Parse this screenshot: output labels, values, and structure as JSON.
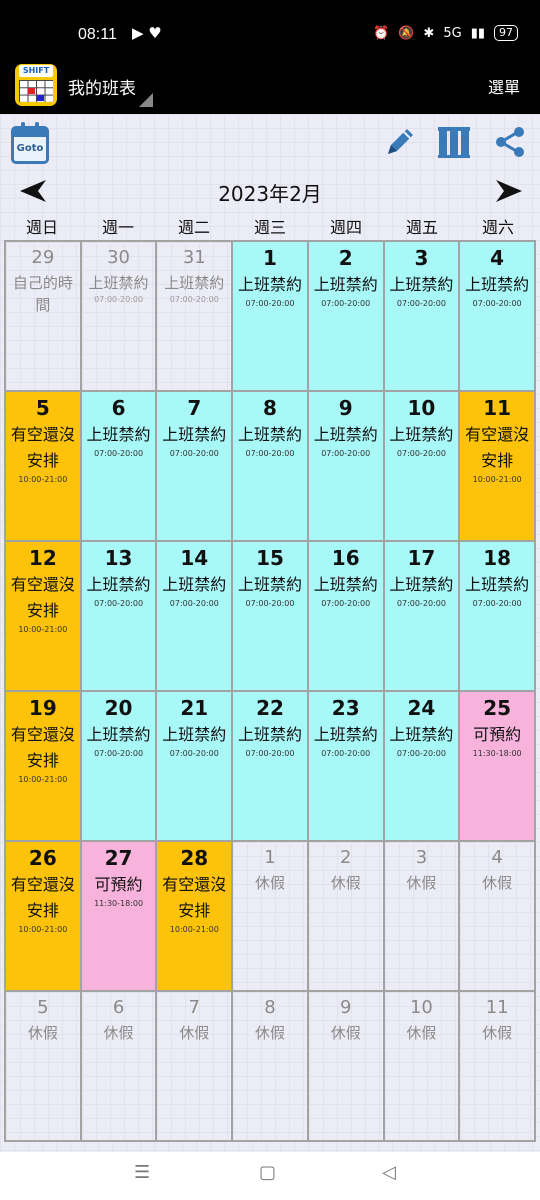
{
  "status_bar": {
    "time": "08:11",
    "left_icons": "▶ ♥",
    "network": "5G",
    "battery": "97"
  },
  "app_bar": {
    "title": "我的班表",
    "app_icon_label": "SHIFT",
    "menu_label": "選單"
  },
  "toolbar": {
    "goto_label": "Goto"
  },
  "calendar": {
    "month_title": "2023年2月",
    "weekdays": [
      "週日",
      "週一",
      "週二",
      "週三",
      "週四",
      "週五",
      "週六"
    ],
    "colors": {
      "work": "#a9f8f8",
      "free": "#fcc30a",
      "book": "#f8b3dc",
      "off": "#ececf6"
    },
    "cells": [
      {
        "day": "29",
        "label": "自己的時間",
        "time": "",
        "type": "other"
      },
      {
        "day": "30",
        "label": "上班禁約",
        "time": "07:00-20:00",
        "type": "other"
      },
      {
        "day": "31",
        "label": "上班禁約",
        "time": "07:00-20:00",
        "type": "other"
      },
      {
        "day": "1",
        "label": "上班禁約",
        "time": "07:00-20:00",
        "type": "work"
      },
      {
        "day": "2",
        "label": "上班禁約",
        "time": "07:00-20:00",
        "type": "work"
      },
      {
        "day": "3",
        "label": "上班禁約",
        "time": "07:00-20:00",
        "type": "work"
      },
      {
        "day": "4",
        "label": "上班禁約",
        "time": "07:00-20:00",
        "type": "work"
      },
      {
        "day": "5",
        "label": "有空還沒安排",
        "time": "10:00-21:00",
        "type": "free"
      },
      {
        "day": "6",
        "label": "上班禁約",
        "time": "07:00-20:00",
        "type": "work"
      },
      {
        "day": "7",
        "label": "上班禁約",
        "time": "07:00-20:00",
        "type": "work"
      },
      {
        "day": "8",
        "label": "上班禁約",
        "time": "07:00-20:00",
        "type": "work"
      },
      {
        "day": "9",
        "label": "上班禁約",
        "time": "07:00-20:00",
        "type": "work"
      },
      {
        "day": "10",
        "label": "上班禁約",
        "time": "07:00-20:00",
        "type": "work"
      },
      {
        "day": "11",
        "label": "有空還沒安排",
        "time": "10:00-21:00",
        "type": "free"
      },
      {
        "day": "12",
        "label": "有空還沒安排",
        "time": "10:00-21:00",
        "type": "free"
      },
      {
        "day": "13",
        "label": "上班禁約",
        "time": "07:00-20:00",
        "type": "work"
      },
      {
        "day": "14",
        "label": "上班禁約",
        "time": "07:00-20:00",
        "type": "work"
      },
      {
        "day": "15",
        "label": "上班禁約",
        "time": "07:00-20:00",
        "type": "work"
      },
      {
        "day": "16",
        "label": "上班禁約",
        "time": "07:00-20:00",
        "type": "work"
      },
      {
        "day": "17",
        "label": "上班禁約",
        "time": "07:00-20:00",
        "type": "work"
      },
      {
        "day": "18",
        "label": "上班禁約",
        "time": "07:00-20:00",
        "type": "work"
      },
      {
        "day": "19",
        "label": "有空還沒安排",
        "time": "10:00-21:00",
        "type": "free"
      },
      {
        "day": "20",
        "label": "上班禁約",
        "time": "07:00-20:00",
        "type": "work"
      },
      {
        "day": "21",
        "label": "上班禁約",
        "time": "07:00-20:00",
        "type": "work"
      },
      {
        "day": "22",
        "label": "上班禁約",
        "time": "07:00-20:00",
        "type": "work"
      },
      {
        "day": "23",
        "label": "上班禁約",
        "time": "07:00-20:00",
        "type": "work"
      },
      {
        "day": "24",
        "label": "上班禁約",
        "time": "07:00-20:00",
        "type": "work"
      },
      {
        "day": "25",
        "label": "可預約",
        "time": "11:30-18:00",
        "type": "book"
      },
      {
        "day": "26",
        "label": "有空還沒安排",
        "time": "10:00-21:00",
        "type": "free"
      },
      {
        "day": "27",
        "label": "可預約",
        "time": "11:30-18:00",
        "type": "book"
      },
      {
        "day": "28",
        "label": "有空還沒安排",
        "time": "10:00-21:00",
        "type": "free"
      },
      {
        "day": "1",
        "label": "休假",
        "time": "",
        "type": "off"
      },
      {
        "day": "2",
        "label": "休假",
        "time": "",
        "type": "off"
      },
      {
        "day": "3",
        "label": "休假",
        "time": "",
        "type": "off"
      },
      {
        "day": "4",
        "label": "休假",
        "time": "",
        "type": "off"
      },
      {
        "day": "5",
        "label": "休假",
        "time": "",
        "type": "off"
      },
      {
        "day": "6",
        "label": "休假",
        "time": "",
        "type": "off"
      },
      {
        "day": "7",
        "label": "休假",
        "time": "",
        "type": "off"
      },
      {
        "day": "8",
        "label": "休假",
        "time": "",
        "type": "off"
      },
      {
        "day": "9",
        "label": "休假",
        "time": "",
        "type": "off"
      },
      {
        "day": "10",
        "label": "休假",
        "time": "",
        "type": "off"
      },
      {
        "day": "11",
        "label": "休假",
        "time": "",
        "type": "off"
      }
    ]
  },
  "icons": {
    "prev": "prev-month-icon",
    "next": "next-month-icon",
    "edit": "pencil-icon",
    "stats": "columns-icon",
    "share": "share-icon"
  }
}
